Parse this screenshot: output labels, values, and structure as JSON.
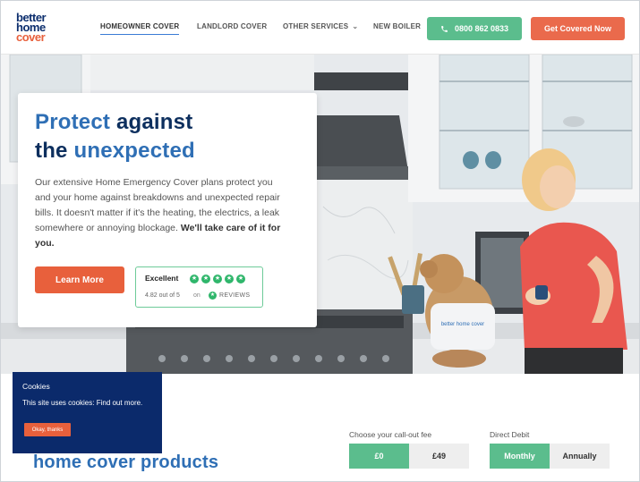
{
  "logo": {
    "better": "better",
    "home": "home",
    "cover": "cover"
  },
  "nav": {
    "items": [
      {
        "label": "HOMEOWNER COVER"
      },
      {
        "label": "LANDLORD COVER"
      },
      {
        "label": "OTHER SERVICES"
      },
      {
        "label": "NEW BOILER"
      }
    ]
  },
  "header": {
    "phone": "0800 862 0833",
    "cta": "Get Covered Now"
  },
  "hero": {
    "headline_1a": "Protect",
    "headline_1b": "against",
    "headline_2a": "the",
    "headline_2b": "unexpected",
    "body": "Our extensive Home Emergency Cover plans protect you and your home against breakdowns and unexpected repair bills. It doesn't matter if it's the heating, the electrics, a leak somewhere or annoying blockage.",
    "body_bold": "We'll take care of it for you.",
    "learn_more": "Learn More",
    "trust_title": "Excellent",
    "trust_score": "4.82 out of 5",
    "trust_on": "on",
    "trust_reviews": "REVIEWS",
    "apron_text": "better home cover"
  },
  "cookies": {
    "title": "Cookies",
    "text": "This site uses cookies: Find out more.",
    "button": "Okay, thanks"
  },
  "products": {
    "title": "home cover products",
    "fee_label": "Choose your call-out fee",
    "fee_options": [
      "£0",
      "£49"
    ],
    "dd_label": "Direct Debit",
    "dd_options": [
      "Monthly",
      "Annually"
    ]
  },
  "colors": {
    "navy": "#0d2f5e",
    "blue": "#2f6fb5",
    "orange": "#e8603c",
    "green": "#5bbd8d",
    "trustpilot_green": "#2fb66b"
  }
}
